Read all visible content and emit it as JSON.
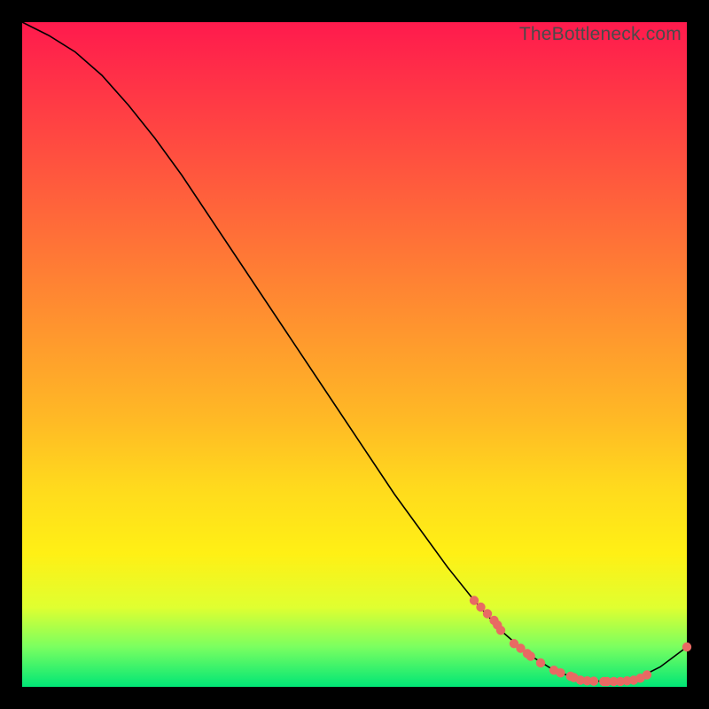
{
  "watermark": "TheBottleneck.com",
  "chart_data": {
    "type": "line",
    "title": "",
    "xlabel": "",
    "ylabel": "",
    "xlim": [
      0,
      100
    ],
    "ylim": [
      0,
      100
    ],
    "curve": {
      "x": [
        0,
        4,
        8,
        12,
        16,
        20,
        24,
        28,
        32,
        36,
        40,
        44,
        48,
        52,
        56,
        60,
        64,
        68,
        72,
        76,
        80,
        84,
        88,
        92,
        96,
        100
      ],
      "y": [
        100,
        98,
        95.5,
        92,
        87.5,
        82.5,
        77,
        71,
        65,
        59,
        53,
        47,
        41,
        35,
        29,
        23.5,
        18,
        13,
        8.5,
        5,
        2.5,
        1,
        0.8,
        1,
        3,
        6
      ]
    },
    "markers": {
      "x": [
        68,
        69,
        70,
        71,
        71.5,
        72,
        74,
        75,
        76,
        76.5,
        78,
        80,
        81,
        82.5,
        83,
        84,
        85,
        86,
        87.5,
        88,
        89,
        90,
        91,
        92,
        93,
        94,
        100
      ],
      "y": [
        13,
        12,
        11,
        10,
        9.3,
        8.5,
        6.5,
        5.8,
        5,
        4.6,
        3.6,
        2.5,
        2.1,
        1.6,
        1.4,
        1,
        0.9,
        0.85,
        0.8,
        0.8,
        0.8,
        0.8,
        0.9,
        1,
        1.3,
        1.8,
        6
      ]
    },
    "marker_color": "#e86a63",
    "line_color": "#000000"
  }
}
